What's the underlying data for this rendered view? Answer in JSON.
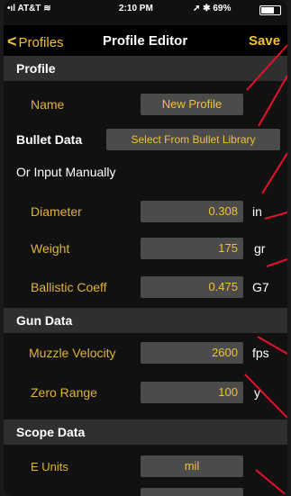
{
  "status_bar": {
    "carrier": "AT&T",
    "time": "2:10 PM",
    "battery_percent": "69%",
    "battery_level": 0.69
  },
  "nav": {
    "back_label": "Profiles",
    "title": "Profile Editor",
    "save_label": "Save"
  },
  "sections": {
    "profile": "Profile",
    "gun_data": "Gun Data",
    "scope_data": "Scope Data"
  },
  "profile": {
    "name_label": "Name",
    "name_value": "New Profile"
  },
  "bullet": {
    "header": "Bullet Data",
    "select_library": "Select From Bullet Library",
    "manual_label": "Or Input Manually",
    "diameter_label": "Diameter",
    "diameter_value": "0.308",
    "diameter_unit": "in",
    "weight_label": "Weight",
    "weight_value": "175",
    "weight_unit": "gr",
    "bc_label": "Ballistic Coeff",
    "bc_value": "0.475",
    "bc_unit": "G7"
  },
  "gun": {
    "muzzle_velocity_label": "Muzzle Velocity",
    "muzzle_velocity_value": "2600",
    "muzzle_velocity_unit": "fps",
    "zero_range_label": "Zero Range",
    "zero_range_value": "100",
    "zero_range_unit": "y"
  },
  "scope": {
    "e_units_label": "E Units",
    "e_units_value": "mil"
  },
  "colors": {
    "accent": "#f1c232",
    "label": "#e0b43a",
    "annotation_line": "#e8112d",
    "field_bg": "#4b4b4b"
  }
}
